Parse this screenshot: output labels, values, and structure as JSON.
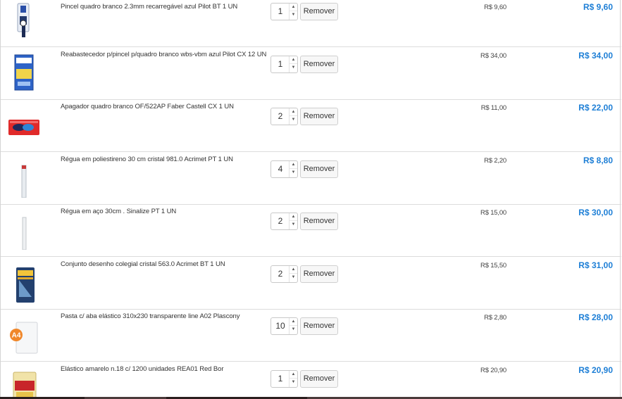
{
  "cart": {
    "remove_label": "Remover",
    "items": [
      {
        "description": "Pincel quadro branco 2.3mm recarregável azul Pilot BT 1 UN",
        "qty": "1",
        "unit_price": "R$ 9,60",
        "total": "R$ 9,60",
        "icon": "marker-pen-icon"
      },
      {
        "description": "Reabastecedor p/pincel p/quadro branco wbs-vbm azul Pilot CX 12 UN",
        "qty": "1",
        "unit_price": "R$ 34,00",
        "total": "R$ 34,00",
        "icon": "ink-refill-box-icon"
      },
      {
        "description": "Apagador quadro branco OF/522AP Faber Castell CX 1 UN",
        "qty": "2",
        "unit_price": "R$ 11,00",
        "total": "R$ 22,00",
        "icon": "eraser-icon"
      },
      {
        "description": "Régua em poliestireno 30 cm cristal 981.0 Acrimet PT 1 UN",
        "qty": "4",
        "unit_price": "R$ 2,20",
        "total": "R$ 8,80",
        "icon": "ruler-icon"
      },
      {
        "description": "Régua em aço 30cm . Sinalize PT 1 UN",
        "qty": "2",
        "unit_price": "R$ 15,00",
        "total": "R$ 30,00",
        "icon": "steel-ruler-icon"
      },
      {
        "description": "Conjunto desenho colegial cristal 563.0 Acrimet BT 1 UN",
        "qty": "2",
        "unit_price": "R$ 15,50",
        "total": "R$ 31,00",
        "icon": "drawing-set-icon"
      },
      {
        "description": "Pasta c/ aba elástico 310x230 transparente line A02 Plascony",
        "qty": "10",
        "unit_price": "R$ 2,80",
        "total": "R$ 28,00",
        "icon": "folder-a4-icon"
      },
      {
        "description": "Elástico amarelo n.18 c/ 1200 unidades REA01 Red Bor",
        "qty": "1",
        "unit_price": "R$ 20,90",
        "total": "R$ 20,90",
        "icon": "rubber-band-bag-icon"
      }
    ],
    "thumb_a4_text": "A4"
  },
  "colors": {
    "total_price": "#1e7fd6",
    "row_border": "#dcdcdc"
  }
}
